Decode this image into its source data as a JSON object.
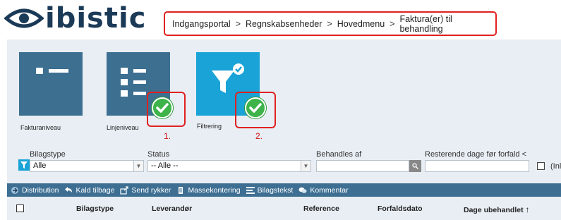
{
  "brand": {
    "name": "ibistic"
  },
  "breadcrumb": [
    "Indgangsportal",
    "Regnskabsenheder",
    "Hovedmenu",
    "Faktura(er) til behandling"
  ],
  "breadcrumb_separator": ">",
  "tiles": [
    {
      "label": "Fakturaniveau",
      "checked": false
    },
    {
      "label": "Linjeniveau",
      "checked": true,
      "annotation": "1."
    },
    {
      "label": "Filtrering",
      "checked": true,
      "annotation": "2."
    }
  ],
  "filters": {
    "bilagstype": {
      "label": "Bilagstype",
      "value": "Alle"
    },
    "status": {
      "label": "Status",
      "value": "-- Alle --"
    },
    "behandles_af": {
      "label": "Behandles af",
      "value": ""
    },
    "resterende": {
      "label": "Resterende dage før forfald <",
      "value": ""
    },
    "checkbox_label": "(Inl"
  },
  "toolbar": {
    "items": [
      {
        "label": "Distribution",
        "icon": "distribution-icon"
      },
      {
        "label": "Kald tilbage",
        "icon": "undo-icon"
      },
      {
        "label": "Send rykker",
        "icon": "reminder-icon"
      },
      {
        "label": "Massekontering",
        "icon": "document-icon"
      },
      {
        "label": "Bilagstekst",
        "icon": "list-icon"
      },
      {
        "label": "Kommentar",
        "icon": "comment-icon"
      }
    ]
  },
  "table": {
    "columns": [
      "Bilagstype",
      "Leverandør",
      "Reference",
      "Forfaldsdato",
      "Dage ubehandlet"
    ],
    "sort_indicator": "↑"
  },
  "colors": {
    "brand_navy": "#1b3a57",
    "tile_dark": "#3d6f91",
    "tile_active": "#1aa3d6",
    "toolbar": "#3e6f93",
    "check_green": "#3db34a",
    "annotation_red": "#e02020",
    "panel_bg": "#e8eef4"
  }
}
